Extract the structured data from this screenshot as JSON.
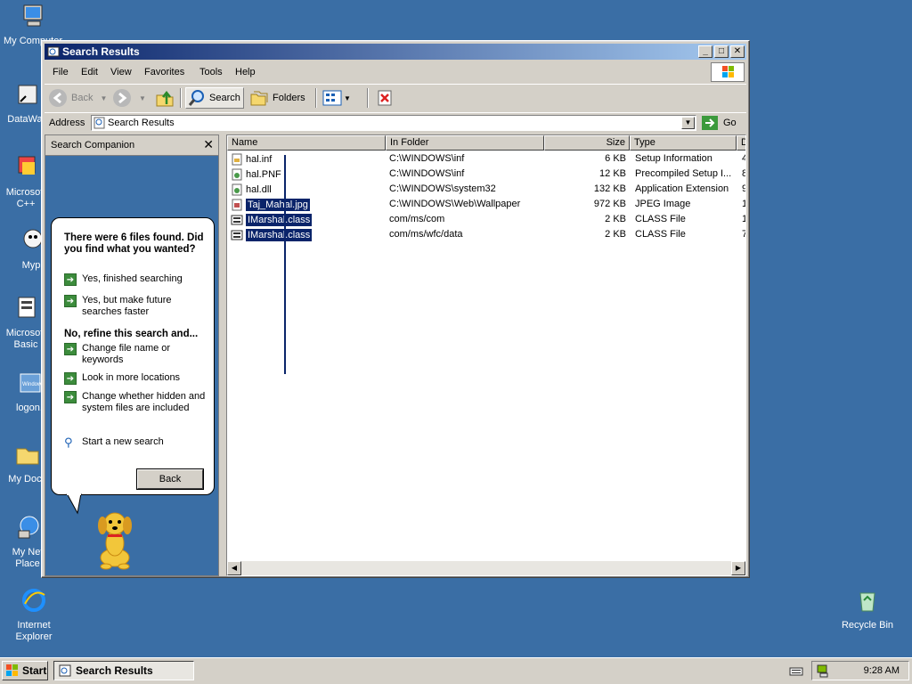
{
  "desktop": {
    "icons": [
      {
        "label": "My Computer",
        "icon": "my-computer-icon"
      },
      {
        "label": "DataWag",
        "icon": "shortcut-icon"
      },
      {
        "label": "Microsoft\nC++",
        "icon": "shortcut-icon"
      },
      {
        "label": "Myp",
        "icon": "shortcut-icon"
      },
      {
        "label": "Microsoft\nBasic",
        "icon": "shortcut-icon"
      },
      {
        "label": "logon.",
        "icon": "windows-logo-icon"
      },
      {
        "label": "My Docu",
        "icon": "folder-icon"
      },
      {
        "label": "My Net\nPlace",
        "icon": "network-icon"
      },
      {
        "label": "Internet\nExplorer",
        "icon": "internet-explorer-icon"
      },
      {
        "label": "Recycle Bin",
        "icon": "recycle-bin-icon"
      }
    ]
  },
  "window": {
    "title": "Search Results",
    "menu": [
      "File",
      "Edit",
      "View",
      "Favorites",
      "Tools",
      "Help"
    ],
    "toolbar": {
      "back": "Back",
      "search": "Search",
      "folders": "Folders"
    },
    "address": {
      "label": "Address",
      "value": "Search Results",
      "go": "Go"
    }
  },
  "companion": {
    "title": "Search Companion",
    "heading": "There were 6 files found. Did you find what you wanted?",
    "yes_finished": "Yes, finished searching",
    "yes_faster": "Yes, but make future searches faster",
    "refine_heading": "No, refine this search and...",
    "change_name": "Change file name or keywords",
    "more_locations": "Look in more locations",
    "hidden_files": "Change whether hidden and system files are included",
    "new_search": "Start a new search",
    "back_button": "Back"
  },
  "results": {
    "columns": [
      "Name",
      "In Folder",
      "Size",
      "Type",
      "D"
    ],
    "rows": [
      {
        "name": "hal.inf",
        "folder": "C:\\WINDOWS\\inf",
        "size": "6 KB",
        "type": "Setup Information",
        "d": "4",
        "selected": false,
        "icon": "inf-file-icon"
      },
      {
        "name": "hal.PNF",
        "folder": "C:\\WINDOWS\\inf",
        "size": "12 KB",
        "type": "Precompiled Setup I...",
        "d": "8",
        "selected": false,
        "icon": "pnf-file-icon"
      },
      {
        "name": "hal.dll",
        "folder": "C:\\WINDOWS\\system32",
        "size": "132 KB",
        "type": "Application Extension",
        "d": "9",
        "selected": false,
        "icon": "dll-file-icon"
      },
      {
        "name": "Taj_Mahal.jpg",
        "folder": "C:\\WINDOWS\\Web\\Wallpaper",
        "size": "972 KB",
        "type": "JPEG Image",
        "d": "1",
        "selected": true,
        "icon": "jpeg-file-icon"
      },
      {
        "name": "IMarshal.class",
        "folder": "com/ms/com",
        "size": "2 KB",
        "type": "CLASS File",
        "d": "1",
        "selected": true,
        "icon": "class-file-icon"
      },
      {
        "name": "IMarshal.class",
        "folder": "com/ms/wfc/data",
        "size": "2 KB",
        "type": "CLASS File",
        "d": "7",
        "selected": true,
        "icon": "class-file-icon"
      }
    ]
  },
  "taskbar": {
    "start": "Start",
    "task": "Search Results",
    "clock": "9:28 AM"
  }
}
